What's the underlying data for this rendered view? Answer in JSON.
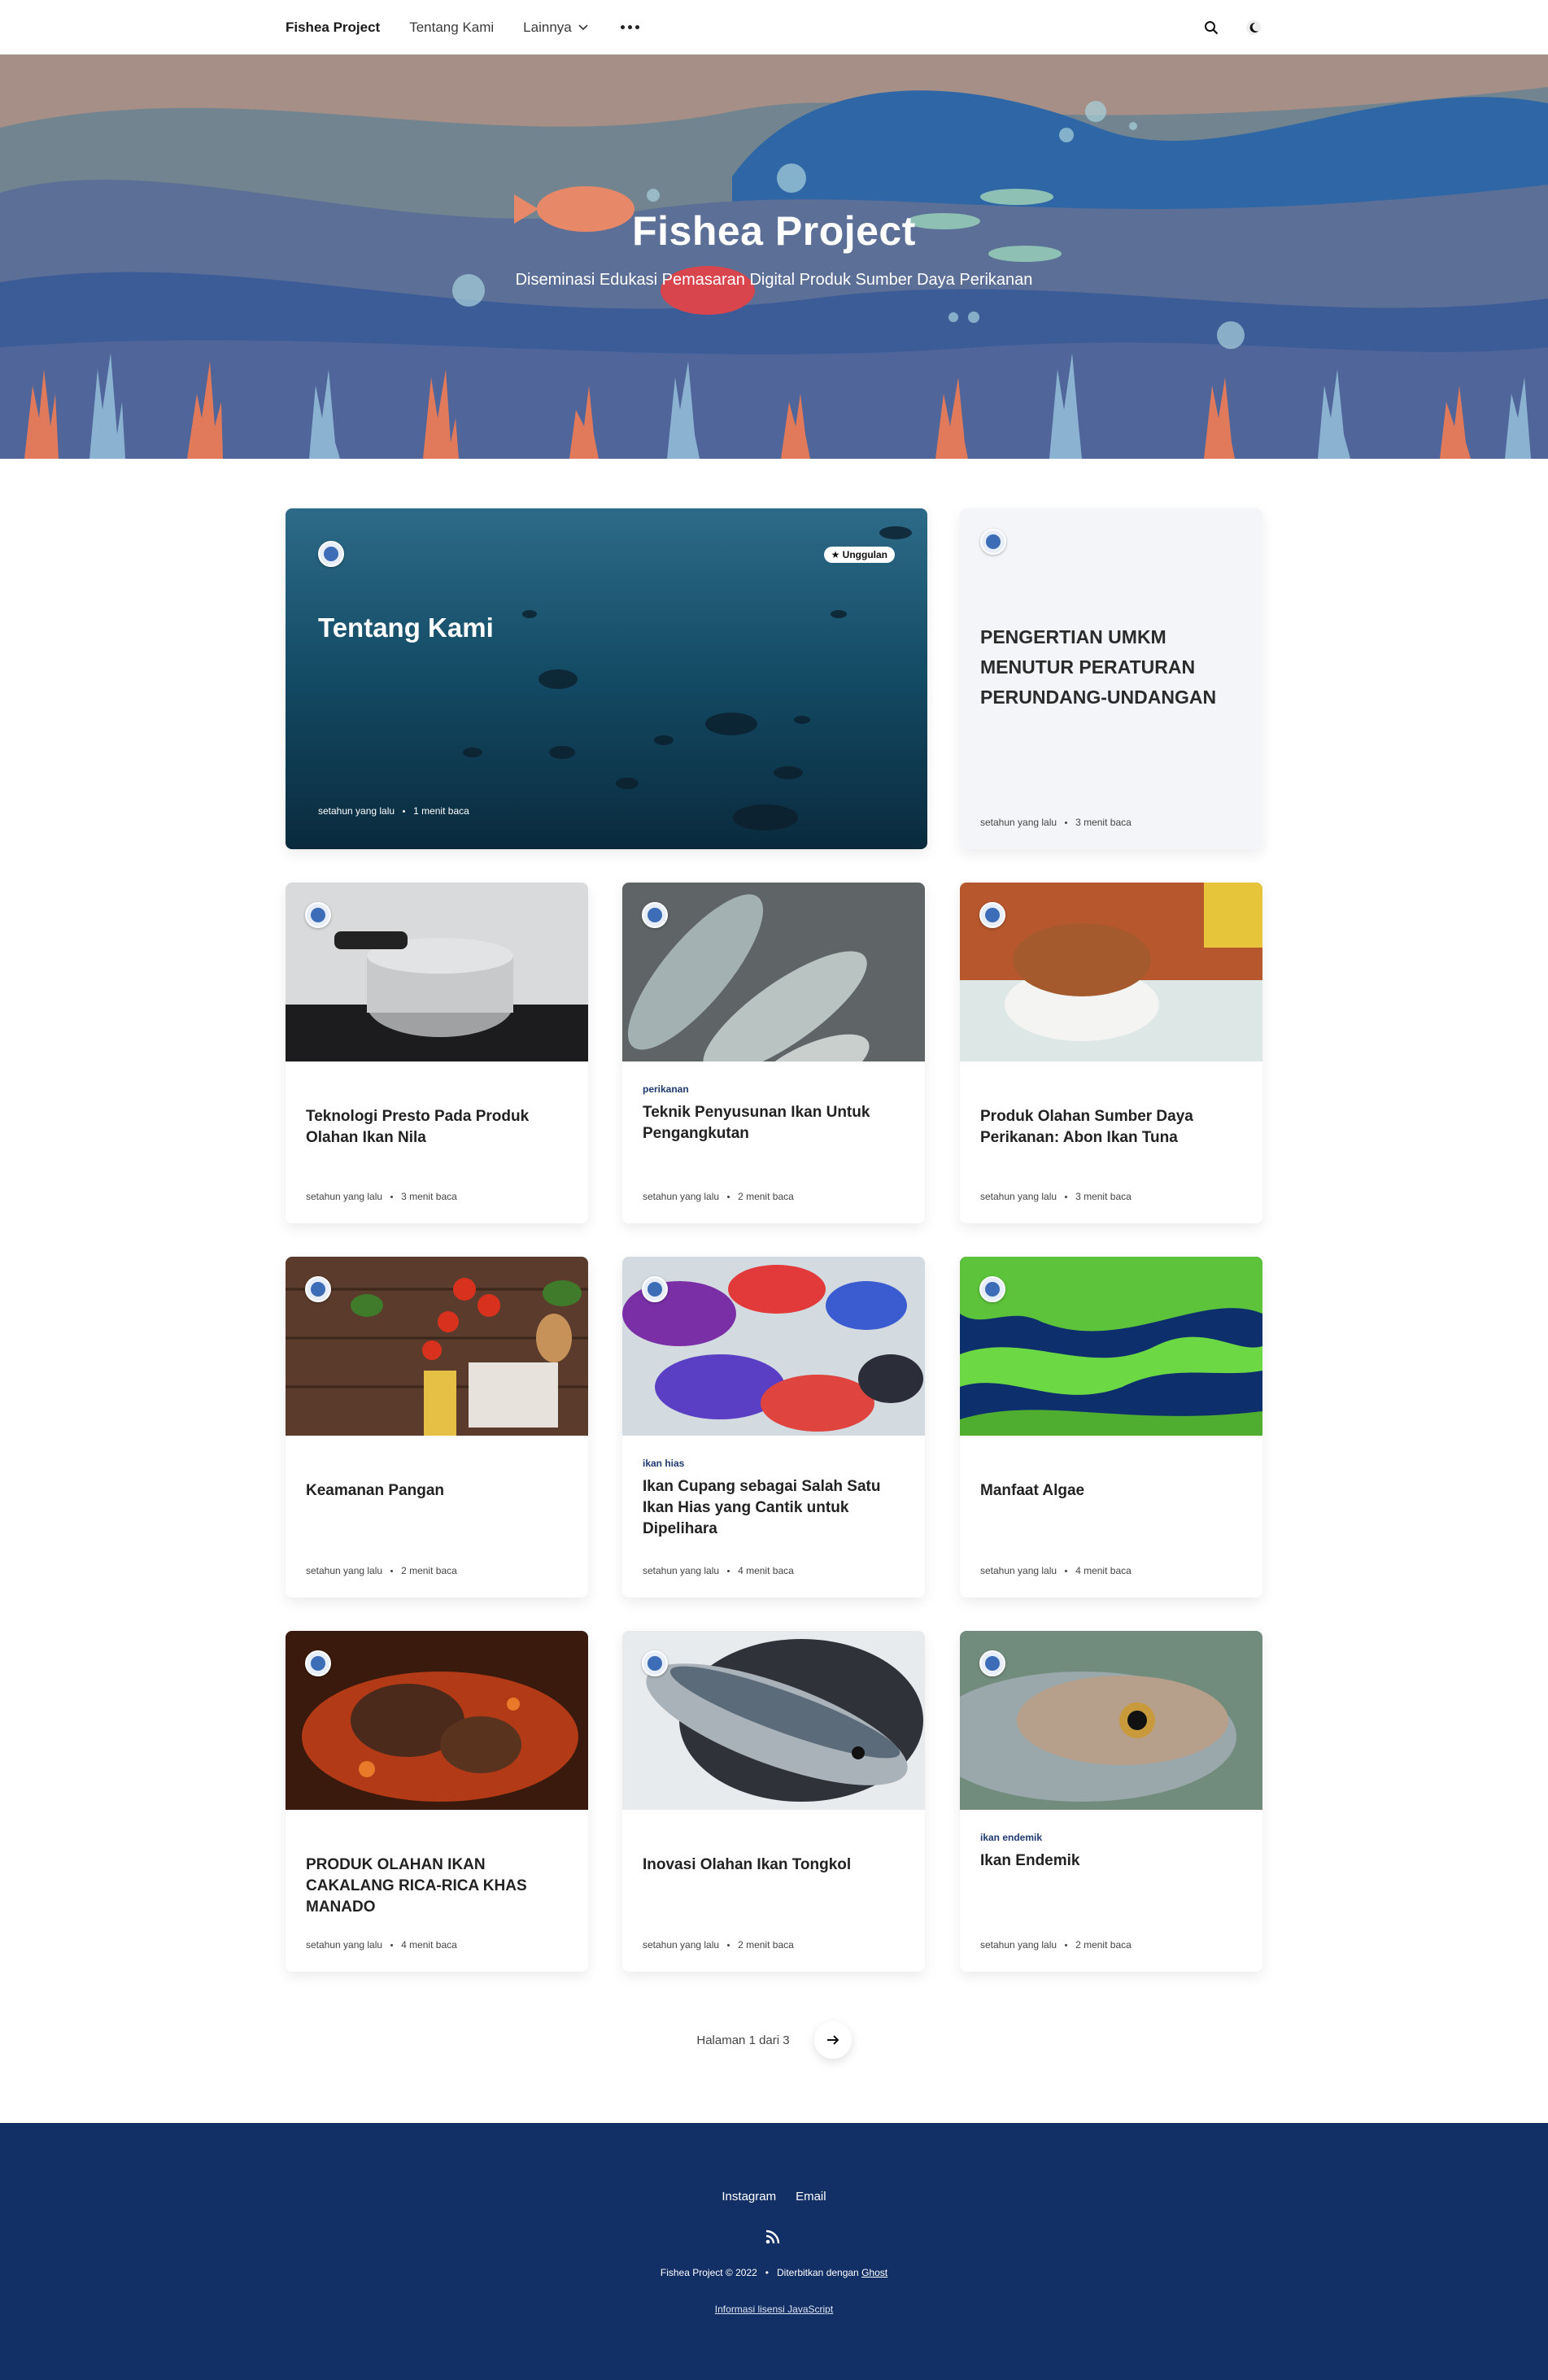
{
  "nav": {
    "brand": "Fishea Project",
    "links": [
      "Tentang Kami",
      "Lainnya"
    ]
  },
  "hero": {
    "title": "Fishea Project",
    "subtitle": "Diseminasi Edukasi Pemasaran Digital Produk Sumber Daya Perikanan"
  },
  "featured": {
    "badge": "★ Unggulan",
    "title": "Tentang Kami",
    "time": "setahun yang lalu",
    "read": "1 menit baca"
  },
  "side_post": {
    "title": "PENGERTIAN UMKM MENUTUR PERATURAN PERUNDANG-UNDANGAN",
    "time": "setahun yang lalu",
    "read": "3 menit baca"
  },
  "posts": [
    {
      "tag": "",
      "title": "Teknologi Presto Pada Produk Olahan Ikan Nila",
      "time": "setahun yang lalu",
      "read": "3 menit baca",
      "img": "presto"
    },
    {
      "tag": "perikanan",
      "title": "Teknik Penyusunan Ikan Untuk Pengangkutan",
      "time": "setahun yang lalu",
      "read": "2 menit baca",
      "img": "fish-grey"
    },
    {
      "tag": "",
      "title": "Produk Olahan Sumber Daya Perikanan: Abon Ikan Tuna",
      "time": "setahun yang lalu",
      "read": "3 menit baca",
      "img": "abon"
    },
    {
      "tag": "",
      "title": "Keamanan Pangan",
      "time": "setahun yang lalu",
      "read": "2 menit baca",
      "img": "food"
    },
    {
      "tag": "ikan hias",
      "title": "Ikan Cupang sebagai Salah Satu Ikan Hias yang Cantik untuk Dipelihara",
      "time": "setahun yang lalu",
      "read": "4 menit baca",
      "img": "betta"
    },
    {
      "tag": "",
      "title": "Manfaat Algae",
      "time": "setahun yang lalu",
      "read": "4 menit baca",
      "img": "algae"
    },
    {
      "tag": "",
      "title": "PRODUK OLAHAN IKAN CAKALANG RICA-RICA KHAS MANADO",
      "time": "setahun yang lalu",
      "read": "4 menit baca",
      "img": "rica"
    },
    {
      "tag": "",
      "title": "Inovasi Olahan Ikan Tongkol",
      "time": "setahun yang lalu",
      "read": "2 menit baca",
      "img": "tuna"
    },
    {
      "tag": "ikan endemik",
      "title": "Ikan Endemik",
      "time": "setahun yang lalu",
      "read": "2 menit baca",
      "img": "arowana"
    }
  ],
  "pager": {
    "text": "Halaman 1 dari 3"
  },
  "footer": {
    "links": [
      "Instagram",
      "Email"
    ],
    "copyright": "Fishea Project © 2022",
    "powered_prefix": "Diterbitkan dengan",
    "powered_link": "Ghost",
    "license": "Informasi lisensi JavaScript"
  }
}
